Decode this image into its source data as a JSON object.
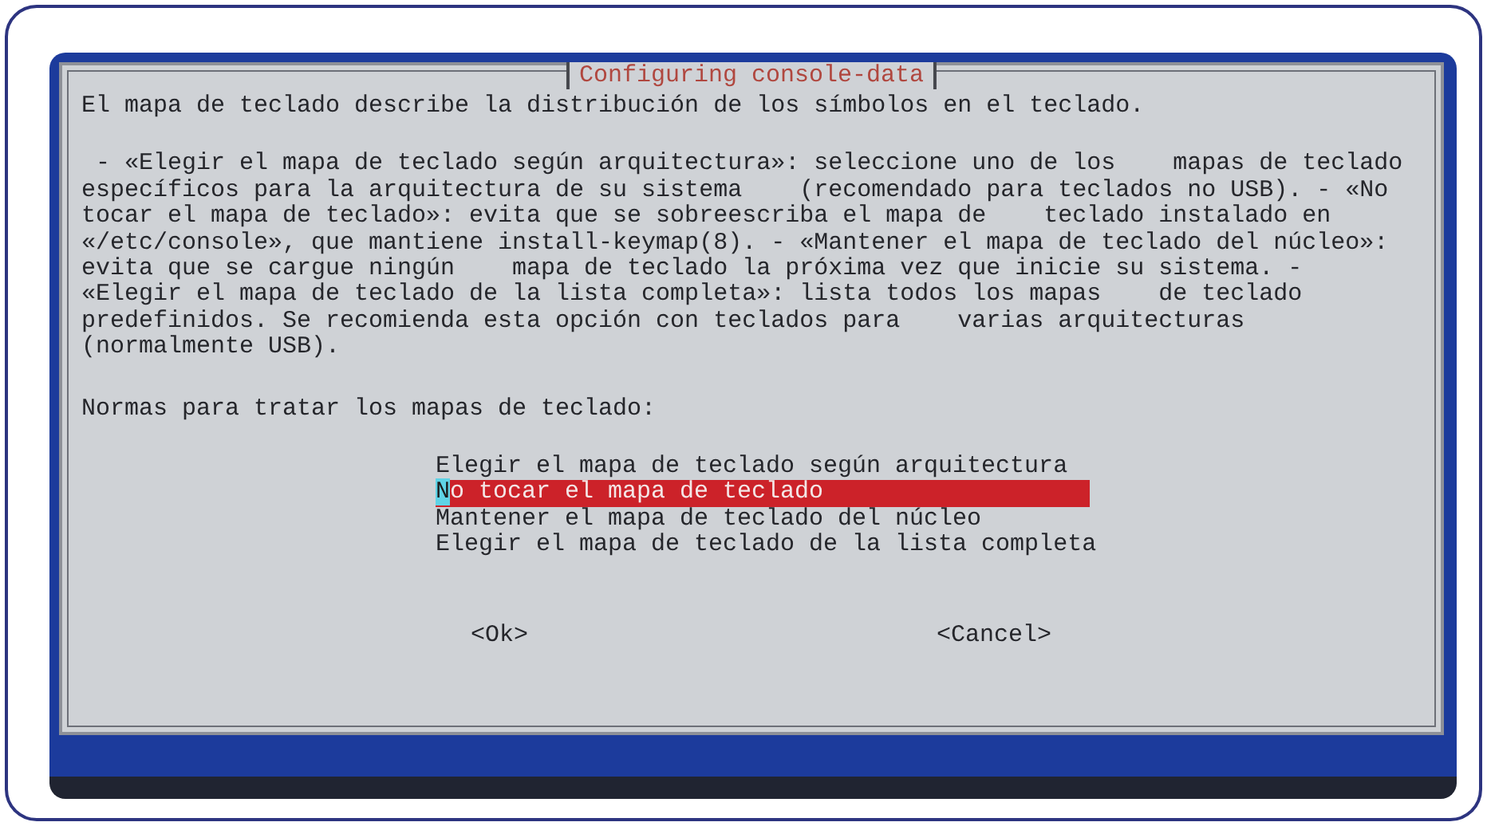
{
  "dialog": {
    "title": "Configuring console-data",
    "intro": "El mapa de teclado describe la distribución de los símbolos en el teclado.",
    "description_lines": [
      " - «Elegir el mapa de teclado según arquitectura»: seleccione uno de los    mapas de teclado",
      "específicos para la arquitectura de su sistema    (recomendado para teclados no USB). - «No",
      "tocar el mapa de teclado»: evita que se sobreescriba el mapa de    teclado instalado en",
      "«/etc/console», que mantiene install-keymap(8). - «Mantener el mapa de teclado del núcleo»:",
      "evita que se cargue ningún    mapa de teclado la próxima vez que inicie su sistema. -",
      "«Elegir el mapa de teclado de la lista completa»: lista todos los mapas    de teclado",
      "predefinidos. Se recomienda esta opción con teclados para    varias arquitecturas",
      "(normalmente USB)."
    ],
    "prompt": "Normas para tratar los mapas de teclado:",
    "options": [
      {
        "label": "Elegir el mapa de teclado según arquitectura",
        "selected": false
      },
      {
        "label": "No tocar el mapa de teclado",
        "selected": true
      },
      {
        "label": "Mantener el mapa de teclado del núcleo",
        "selected": false
      },
      {
        "label": "Elegir el mapa de teclado de la lista completa",
        "selected": false
      }
    ],
    "buttons": [
      "<Ok>",
      "<Cancel>"
    ]
  }
}
